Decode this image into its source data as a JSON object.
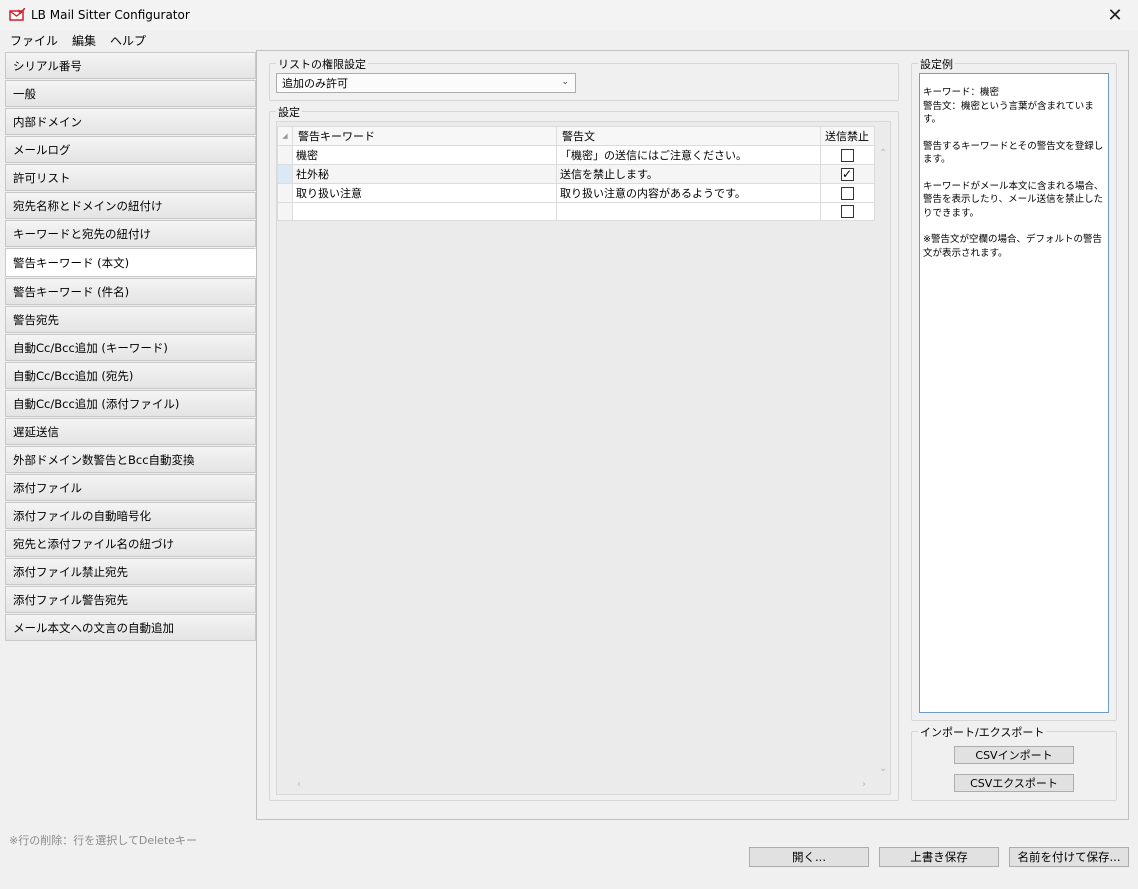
{
  "window": {
    "title": "LB Mail Sitter Configurator",
    "close_glyph": "✕"
  },
  "menu": [
    "ファイル",
    "編集",
    "ヘルプ"
  ],
  "nav": {
    "items": [
      "シリアル番号",
      "一般",
      "内部ドメイン",
      "メールログ",
      "許可リスト",
      "宛先名称とドメインの紐付け",
      "キーワードと宛先の紐付け",
      "警告キーワード (本文)",
      "警告キーワード (件名)",
      "警告宛先",
      "自動Cc/Bcc追加 (キーワード)",
      "自動Cc/Bcc追加 (宛先)",
      "自動Cc/Bcc追加 (添付ファイル)",
      "遅延送信",
      "外部ドメイン数警告とBcc自動変換",
      "添付ファイル",
      "添付ファイルの自動暗号化",
      "宛先と添付ファイル名の紐づけ",
      "添付ファイル禁止宛先",
      "添付ファイル警告宛先",
      "メール本文への文言の自動追加"
    ],
    "active_index": 7
  },
  "permission": {
    "group_label": "リストの権限設定",
    "selected": "追加のみ許可"
  },
  "settings": {
    "group_label": "設定",
    "columns": [
      "警告キーワード",
      "警告文",
      "送信禁止"
    ],
    "rows": [
      {
        "keyword": "機密",
        "message": "「機密」の送信にはご注意ください。",
        "block": false
      },
      {
        "keyword": "社外秘",
        "message": "送信を禁止します。",
        "block": true
      },
      {
        "keyword": "取り扱い注意",
        "message": "取り扱い注意の内容があるようです。",
        "block": false
      },
      {
        "keyword": "",
        "message": "",
        "block": false
      }
    ],
    "selected_row": 1
  },
  "example": {
    "group_label": "設定例",
    "paragraphs": [
      "キーワード：機密\n警告文：機密という言葉が含まれています。",
      "警告するキーワードとその警告文を登録します。",
      "キーワードがメール本文に含まれる場合、警告を表示したり、メール送信を禁止したりできます。",
      "※警告文が空欄の場合、デフォルトの警告文が表示されます。"
    ]
  },
  "import_export": {
    "group_label": "インポート/エクスポート",
    "import_label": "CSVインポート",
    "export_label": "CSVエクスポート"
  },
  "footer": {
    "note": "※行の削除：行を選択してDeleteキー",
    "open_label": "開く...",
    "save_label": "上書き保存",
    "save_as_label": "名前を付けて保存..."
  },
  "colors": {
    "accent_border": "#6e9bc8",
    "selected_rowhead": "#dbe8f6",
    "icon_red": "#d0202a"
  }
}
